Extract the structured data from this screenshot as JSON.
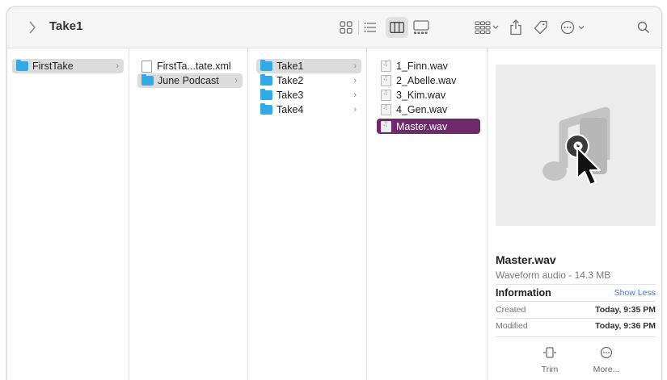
{
  "window": {
    "title": "Take1"
  },
  "toolbar": {
    "icons": [
      "chevron-right-icon",
      "icon-view-icon",
      "list-view-icon",
      "column-view-icon",
      "gallery-view-icon",
      "group-icon",
      "share-icon",
      "tag-icon",
      "more-icon",
      "search-icon"
    ]
  },
  "columns": [
    {
      "items": [
        {
          "label": "FirstTake",
          "kind": "folder",
          "selected": "gray",
          "chevron": "›"
        }
      ]
    },
    {
      "items": [
        {
          "label": "FirstTa...tate.xml",
          "kind": "doc"
        },
        {
          "label": "June Podcast",
          "kind": "folder",
          "selected": "gray",
          "chevron": "›"
        }
      ]
    },
    {
      "items": [
        {
          "label": "Take1",
          "kind": "folder",
          "selected": "gray",
          "chevron": "›"
        },
        {
          "label": "Take2",
          "kind": "folder",
          "chevron": "›"
        },
        {
          "label": "Take3",
          "kind": "folder",
          "chevron": "›"
        },
        {
          "label": "Take4",
          "kind": "folder",
          "chevron": "›"
        }
      ]
    },
    {
      "items": [
        {
          "label": "1_Finn.wav",
          "kind": "audio"
        },
        {
          "label": "2_Abelle.wav",
          "kind": "audio"
        },
        {
          "label": "3_Kim.wav",
          "kind": "audio"
        },
        {
          "label": "4_Gen.wav",
          "kind": "audio"
        },
        {
          "label": "Master.wav",
          "kind": "audio",
          "selected": "purple"
        }
      ]
    }
  ],
  "preview": {
    "filename": "Master.wav",
    "kind": "Waveform audio - 14.3 MB",
    "info_heading": "Information",
    "show_less": "Show Less",
    "created_label": "Created",
    "created_value": "Today, 9:35 PM",
    "modified_label": "Modified",
    "modified_value": "Today, 9:36 PM",
    "actions": [
      {
        "label": "Trim",
        "icon": "trim-icon"
      },
      {
        "label": "More...",
        "icon": "more-circle-icon"
      }
    ]
  },
  "colors": {
    "selection_purple": "#6e2a6a",
    "folder_blue": "#33a9e6",
    "link_blue": "#2f7cf6"
  }
}
